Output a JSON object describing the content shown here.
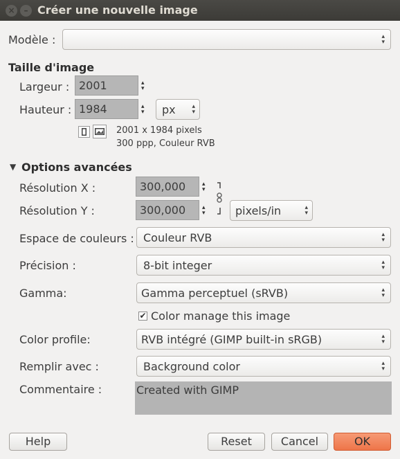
{
  "window": {
    "title": "Créer une nouvelle image",
    "close_glyph": "×",
    "minimize_glyph": "–"
  },
  "template": {
    "label": "Modèle :",
    "value": ""
  },
  "image_size": {
    "heading": "Taille d'image",
    "width_label": "Largeur :",
    "width_value": "2001",
    "height_label": "Hauteur :",
    "height_value": "1984",
    "unit": "px",
    "info_line1": "2001 x 1984 pixels",
    "info_line2": "300 ppp, Couleur RVB"
  },
  "advanced": {
    "heading": "Options avancées",
    "res_x_label": "Résolution X :",
    "res_x_value": "300,000",
    "res_y_label": "Résolution Y :",
    "res_y_value": "300,000",
    "res_unit": "pixels/in",
    "colorspace_label": "Espace de couleurs :",
    "colorspace_value": "Couleur RVB",
    "precision_label": "Précision :",
    "precision_value": "8-bit integer",
    "gamma_label": "Gamma:",
    "gamma_value": "Gamma perceptuel (sRVB)",
    "color_manage_label": "Color manage this image",
    "color_manage_checked": true,
    "profile_label": "Color profile:",
    "profile_value": "RVB intégré (GIMP built-in sRGB)",
    "fill_label": "Remplir avec :",
    "fill_value": "Background color",
    "comment_label": "Commentaire :",
    "comment_value": "Created with GIMP"
  },
  "buttons": {
    "help": "Help",
    "reset": "Reset",
    "cancel": "Cancel",
    "ok": "OK"
  }
}
